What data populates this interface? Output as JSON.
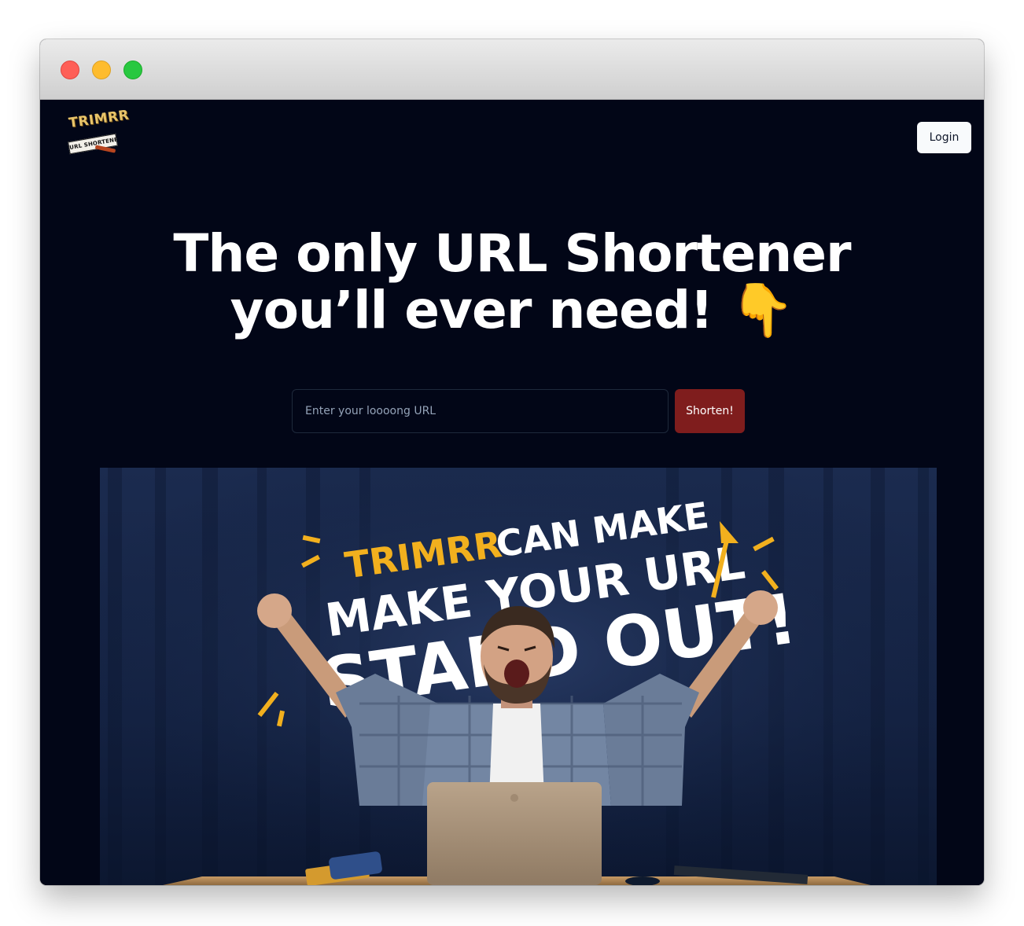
{
  "window": {
    "controls": [
      "close",
      "minimize",
      "maximize"
    ]
  },
  "header": {
    "logo": {
      "title": "TRIMRR",
      "subtitle": "URL SHORTENER"
    },
    "login_label": "Login"
  },
  "hero": {
    "headline_line1": "The only URL Shortener",
    "headline_line2": "you’ll ever need! 👇"
  },
  "form": {
    "url_placeholder": "Enter your loooong URL",
    "url_value": "",
    "shorten_label": "Shorten!"
  },
  "banner": {
    "line1_brand": "TRIMRR",
    "line1_rest": "CAN MAKE",
    "line2": "MAKE YOUR URL",
    "line3": "STAND OUT!"
  },
  "colors": {
    "page_bg": "#020617",
    "accent_button": "#7f1d1d",
    "banner_brand": "#f2b01e",
    "banner_text": "#ffffff",
    "logo_gold": "#e8c46a"
  }
}
